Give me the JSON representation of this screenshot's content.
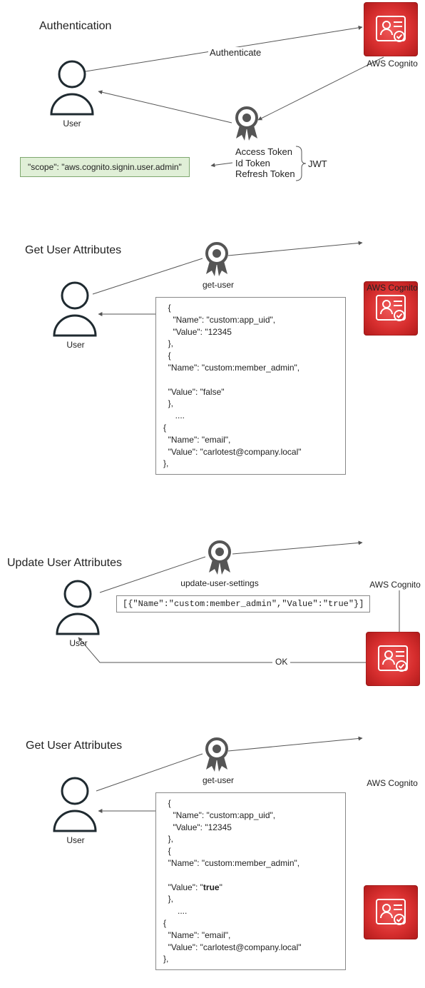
{
  "sections": {
    "auth": {
      "title": "Authentication",
      "user_label": "User",
      "cognito_label": "AWS Cognito"
    },
    "get1": {
      "title": "Get User Attributes",
      "user_label": "User",
      "cognito_label": "AWS Cognito",
      "op": "get-user"
    },
    "update": {
      "title": "Update User Attributes",
      "user_label": "User",
      "cognito_label": "AWS Cognito",
      "op": "update-user-settings",
      "response": "OK"
    },
    "get2": {
      "title": "Get User Attributes",
      "user_label": "User",
      "cognito_label": "AWS Cognito",
      "op": "get-user"
    }
  },
  "arrows": {
    "authenticate": "Authenticate",
    "jwt": "JWT"
  },
  "tokens": {
    "line1": "Access Token",
    "line2": "Id Token",
    "line3": "Refresh Token"
  },
  "scope_box": "\"scope\": \"aws.cognito.signin.user.admin\"",
  "code1": "  {\n    \"Name\": \"custom:app_uid\",\n    \"Value\": \"12345\n  },\n  {\n  \"Name\": \"custom:member_admin\",\n\n  \"Value\": \"false\"\n  },\n     ....\n{\n  \"Name\": \"email\",\n  \"Value\": \"carlotest@company.local\"\n},",
  "update_payload": "[{\"Name\":\"custom:member_admin\",\"Value\":\"true\"}]",
  "code2_pre": "  {\n    \"Name\": \"custom:app_uid\",\n    \"Value\": \"12345\n  },\n  {\n  \"Name\": \"custom:member_admin\",\n\n  \"Value\": \"",
  "code2_bold": "true",
  "code2_post": "\"\n  },\n      ....\n{\n  \"Name\": \"email\",\n  \"Value\": \"carlotest@company.local\"\n},"
}
